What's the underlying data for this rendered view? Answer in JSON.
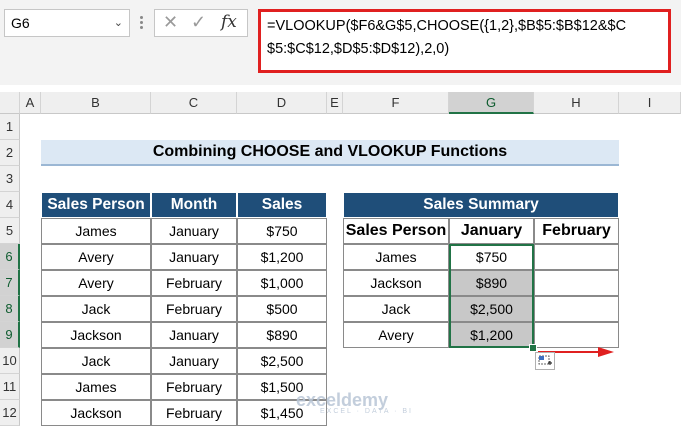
{
  "formula_bar": {
    "name_box": "G6",
    "cancel_glyph": "✕",
    "enter_glyph": "✓",
    "fx_glyph": "fx",
    "formula": "=VLOOKUP($F6&G$5,CHOOSE({1,2},$B$5:$B$12&$C$5:$C$12,$D$5:$D$12),2,0)"
  },
  "columns": [
    "A",
    "B",
    "C",
    "D",
    "E",
    "F",
    "G",
    "H",
    "I"
  ],
  "rows": [
    "1",
    "2",
    "3",
    "4",
    "5",
    "6",
    "7",
    "8",
    "9",
    "10",
    "11",
    "12"
  ],
  "title": "Combining CHOOSE and VLOOKUP Functions",
  "left_table": {
    "headers": [
      "Sales Person",
      "Month",
      "Sales"
    ],
    "rows": [
      [
        "James",
        "January",
        "$750"
      ],
      [
        "Avery",
        "January",
        "$1,200"
      ],
      [
        "Avery",
        "February",
        "$1,000"
      ],
      [
        "Jack",
        "February",
        "$500"
      ],
      [
        "Jackson",
        "January",
        "$890"
      ],
      [
        "Jack",
        "January",
        "$2,500"
      ],
      [
        "James",
        "February",
        "$1,500"
      ],
      [
        "Jackson",
        "February",
        "$1,450"
      ]
    ]
  },
  "summary": {
    "title": "Sales Summary",
    "headers": [
      "Sales Person",
      "January",
      "February"
    ],
    "rows": [
      [
        "James",
        "$750",
        ""
      ],
      [
        "Jackson",
        "$890",
        ""
      ],
      [
        "Jack",
        "$2,500",
        ""
      ],
      [
        "Avery",
        "$1,200",
        ""
      ]
    ]
  },
  "watermark": {
    "name": "exceldemy",
    "tagline": "EXCEL · DATA · BI"
  },
  "colors": {
    "header_bg": "#1f4e79",
    "title_bg": "#dce8f4",
    "selection": "#217346",
    "highlight": "#e02020"
  }
}
